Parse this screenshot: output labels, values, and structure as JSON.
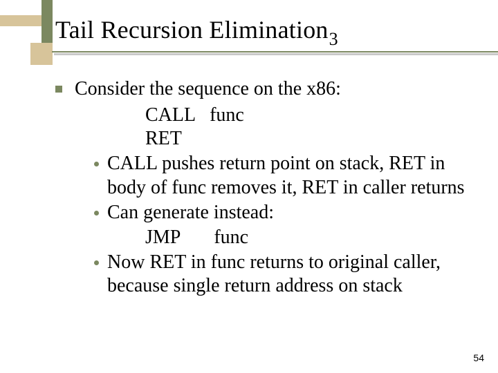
{
  "title": {
    "main": "Tail Recursion Elimination",
    "sub": "3"
  },
  "heading": "Consider the sequence on the x86:",
  "code1": {
    "line1": "CALL   func",
    "line2": "RET"
  },
  "bullets": {
    "b1": "CALL pushes return point on stack, RET in body of func removes it, RET in caller returns",
    "b2": "Can generate instead:",
    "b3": "Now RET in func returns to original caller, because single return address on stack"
  },
  "code2": {
    "line1": "JMP       func"
  },
  "page_number": "54"
}
